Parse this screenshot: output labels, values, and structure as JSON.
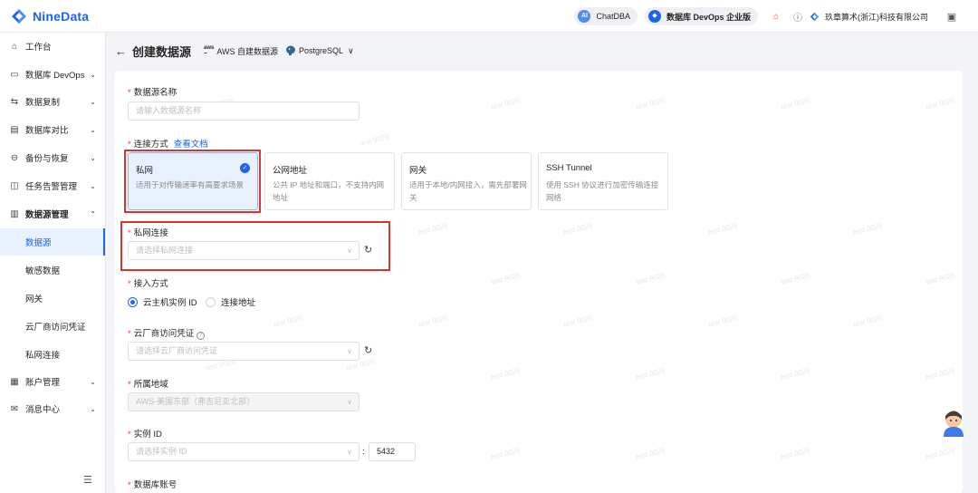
{
  "app": {
    "brand": "NineData"
  },
  "topbar": {
    "chatdba": "ChatDBA",
    "devops_edition": "数据库 DevOps 企业版",
    "company": "玖章算术(浙江)科技有限公司"
  },
  "sidebar": {
    "items": [
      {
        "label": "工作台",
        "icon": "home-icon"
      },
      {
        "label": "数据库 DevOps",
        "icon": "devops-icon"
      },
      {
        "label": "数据复制",
        "icon": "replicate-icon"
      },
      {
        "label": "数据库对比",
        "icon": "compare-icon"
      },
      {
        "label": "备份与恢复",
        "icon": "backup-icon"
      },
      {
        "label": "任务告警管理",
        "icon": "alert-icon"
      },
      {
        "label": "数据源管理",
        "icon": "datasource-icon"
      },
      {
        "label": "账户管理",
        "icon": "account-icon"
      },
      {
        "label": "消息中心",
        "icon": "message-icon"
      }
    ],
    "sub_items": [
      "数据源",
      "敏感数据",
      "网关",
      "云厂商访问凭证",
      "私网连接"
    ]
  },
  "header": {
    "title": "创建数据源",
    "aws_badge": "aws",
    "crumb_source": "AWS 自建数据源",
    "crumb_engine": "PostgreSQL"
  },
  "form": {
    "name_label": "数据源名称",
    "name_placeholder": "请输入数据源名称",
    "conn_label": "连接方式",
    "conn_doc_link": "查看文档",
    "conn_options": [
      {
        "title": "私网",
        "desc": "适用于对传输速率有高要求场景"
      },
      {
        "title": "公网地址",
        "desc": "公共 IP 地址和端口，不支持内网地址"
      },
      {
        "title": "网关",
        "desc": "适用于本地/内网接入，需先部署网关"
      },
      {
        "title": "SSH Tunnel",
        "desc": "使用 SSH 协议进行加密传输连接网络"
      }
    ],
    "private_label": "私网连接",
    "private_placeholder": "请选择私网连接",
    "access_label": "接入方式",
    "access_opt1": "云主机实例 ID",
    "access_opt2": "连接地址",
    "cred_label": "云厂商访问凭证",
    "cred_placeholder": "请选择云厂商访问凭证",
    "region_label": "所属地域",
    "region_value": "AWS-美国东部（弗吉尼亚北部）",
    "instance_label": "实例 ID",
    "instance_placeholder": "请选择实例 ID",
    "port_sep": ":",
    "port_value": "5432",
    "account_label": "数据库账号"
  },
  "watermark": "test 9026",
  "colors": {
    "accent": "#1c64f2",
    "highlight": "#d9362b",
    "required": "#e53e3e"
  }
}
